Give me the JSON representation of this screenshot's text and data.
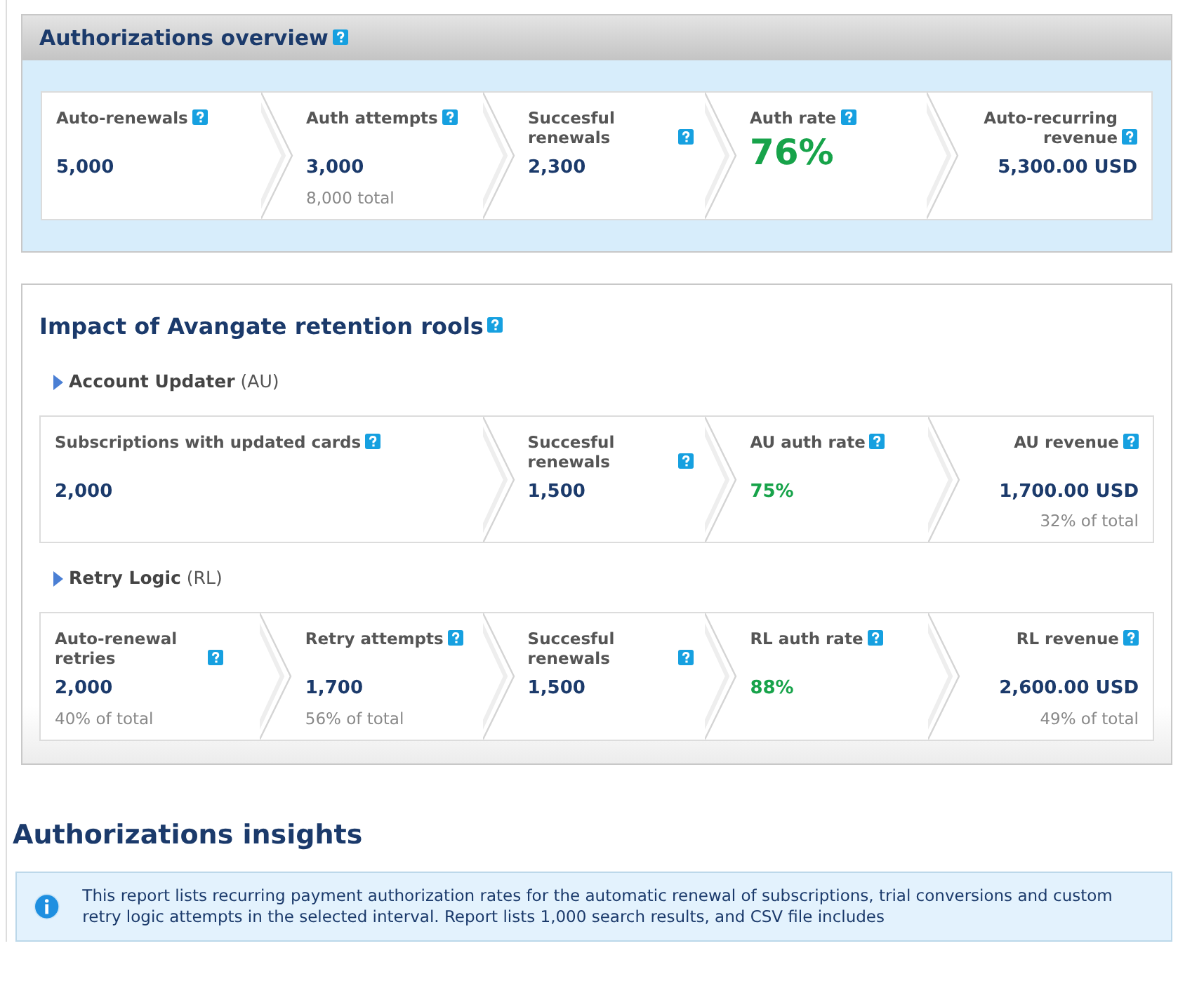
{
  "overview": {
    "title": "Authorizations overview",
    "steps": [
      {
        "label": "Auto-renewals",
        "value": "5,000",
        "kind": "number"
      },
      {
        "label": "Auth attempts",
        "value": "3,000",
        "note": "8,000 total",
        "kind": "number"
      },
      {
        "label": "Succesful renewals",
        "value": "2,300",
        "kind": "number"
      },
      {
        "label": "Auth rate",
        "value": "76%",
        "kind": "big-rate"
      },
      {
        "label": "Auto-recurring revenue",
        "value": "5,300.00 USD",
        "kind": "number"
      }
    ]
  },
  "impact": {
    "title": "Impact of Avangate retention rools",
    "groups": [
      {
        "heading": "**Account Updater** (AU)",
        "steps": [
          {
            "label": "Subscriptions with updated cards",
            "value": "2,000",
            "kind": "number"
          },
          {
            "label": "Succesful renewals",
            "value": "1,500",
            "kind": "number"
          },
          {
            "label": "AU auth rate",
            "value": "75%",
            "kind": "rate"
          },
          {
            "label": "AU revenue",
            "value": "1,700.00 USD",
            "note": "32% of total",
            "kind": "number"
          }
        ]
      },
      {
        "heading": "**Retry Logic** (RL)",
        "steps": [
          {
            "label": "Auto-renewal retries",
            "value": "2,000",
            "note": "40% of total",
            "kind": "number"
          },
          {
            "label": "Retry attempts",
            "value": "1,700",
            "note": "56% of total",
            "kind": "number"
          },
          {
            "label": "Succesful renewals",
            "value": "1,500",
            "kind": "number"
          },
          {
            "label": "RL auth rate",
            "value": "88%",
            "kind": "rate"
          },
          {
            "label": "RL revenue",
            "value": "2,600.00 USD",
            "note": "49% of total",
            "kind": "number"
          }
        ]
      }
    ]
  },
  "insights": {
    "title": "Authorizations insights",
    "info": "This report lists recurring payment authorization rates for the automatic renewal of subscriptions, trial conversions and custom retry logic attempts in the selected interval. Report lists 1,000 search results, and CSV file includes"
  }
}
